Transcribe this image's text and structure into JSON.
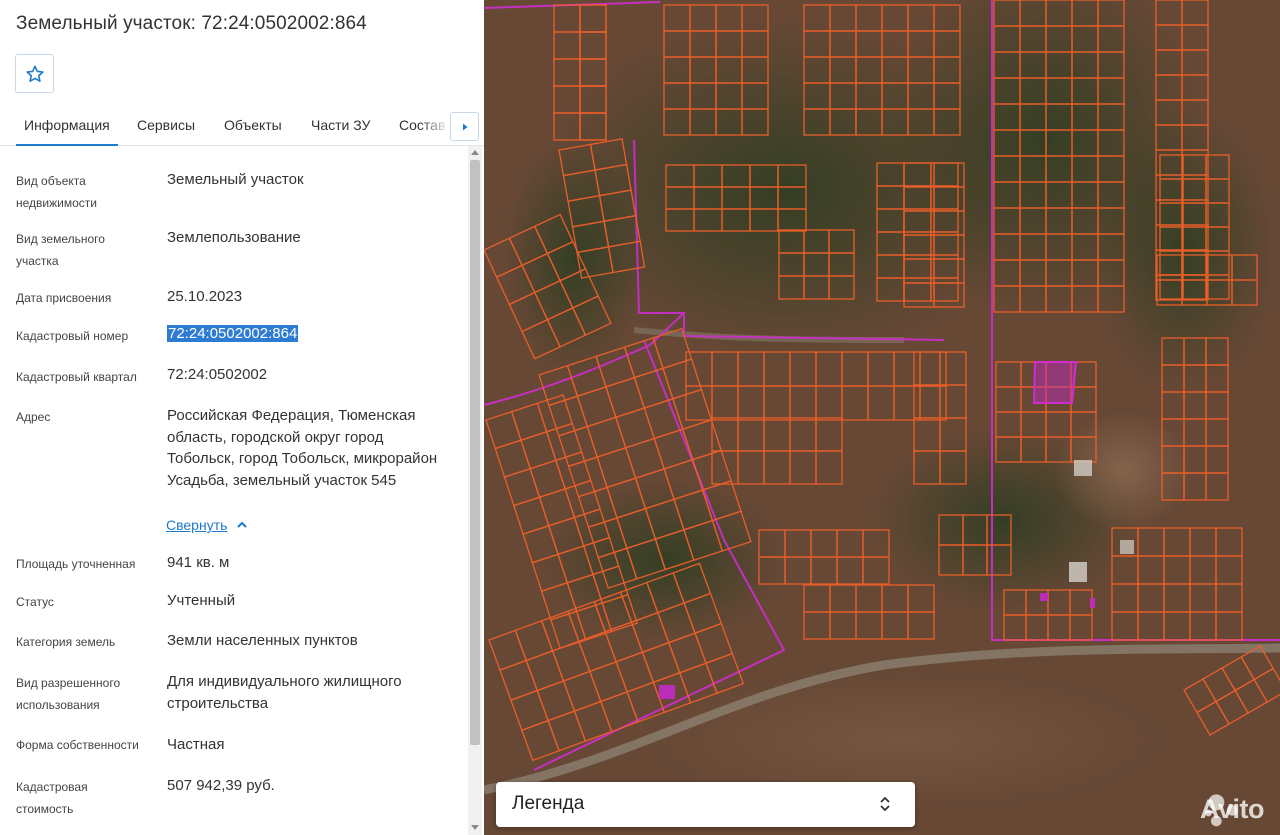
{
  "title": "Земельный участок: 72:24:0502002:864",
  "tabs": [
    "Информация",
    "Сервисы",
    "Объекты",
    "Части ЗУ",
    "Состав"
  ],
  "fields": {
    "object_type": {
      "label": "Вид объекта недвижимости",
      "value": "Земельный участок"
    },
    "land_type": {
      "label": "Вид земельного участка",
      "value": "Землепользование"
    },
    "assign_date": {
      "label": "Дата присвоения",
      "value": "25.10.2023"
    },
    "cad_number": {
      "label": "Кадастровый номер",
      "value": "72:24:0502002:864"
    },
    "cad_quarter": {
      "label": "Кадастровый квартал",
      "value": "72:24:0502002"
    },
    "address": {
      "label": "Адрес",
      "value": "Российская Федерация, Тюменская область, городской округ город Тобольск, город Тобольск, микрорайон Усадьба, земельный участок 545"
    },
    "area": {
      "label": "Площадь уточненная",
      "value": "941 кв. м"
    },
    "status": {
      "label": "Статус",
      "value": "Учтенный"
    },
    "category": {
      "label": "Категория земель",
      "value": "Земли населенных пунктов"
    },
    "permitted_use": {
      "label": "Вид разрешенного использования",
      "value": "Для индивидуального жилищного строительства"
    },
    "ownership": {
      "label": "Форма собственности",
      "value": "Частная"
    },
    "cad_cost": {
      "label": "Кадастровая стоимость",
      "value": "507 942,39 руб."
    }
  },
  "collapse_link": "Свернуть",
  "legend": {
    "label": "Легенда"
  },
  "watermark": "Avito",
  "colors": {
    "accent": "#1f7acb",
    "parcel_line": "#f0602a",
    "boundary_line": "#d02cd0",
    "selected_parcel": "#c42ac4"
  },
  "icons": [
    "star-icon",
    "caret-right-icon",
    "chevron-up-icon",
    "updown-chevron-icon"
  ]
}
